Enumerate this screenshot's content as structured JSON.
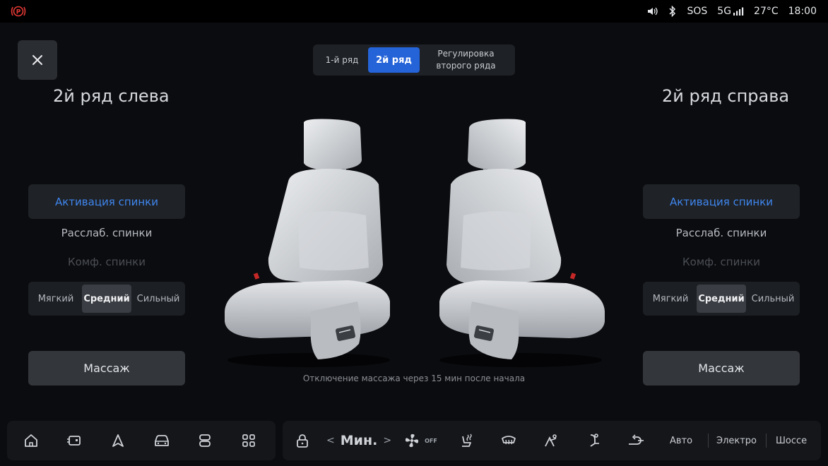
{
  "status_bar": {
    "sos": "SOS",
    "network": "5G",
    "temperature": "27°C",
    "time": "18:00",
    "icons": [
      "parking-brake-icon",
      "volume-icon",
      "bluetooth-icon",
      "signal-icon"
    ]
  },
  "tabs": [
    {
      "label": "1-й ряд",
      "active": false
    },
    {
      "label": "2й ряд",
      "active": true
    },
    {
      "label": "Регулировка второго ряда",
      "active": false
    }
  ],
  "left": {
    "title": "2й ряд слева",
    "options": [
      "Активация спинки",
      "Расслаб. спинки",
      "Комф. спинки"
    ],
    "intensity": [
      "Мягкий",
      "Средний",
      "Сильный"
    ],
    "intensity_selected": "Средний",
    "massage_label": "Массаж"
  },
  "right": {
    "title": "2й ряд справа",
    "options": [
      "Активация спинки",
      "Расслаб. спинки",
      "Комф. спинки"
    ],
    "intensity": [
      "Мягкий",
      "Средний",
      "Сильный"
    ],
    "intensity_selected": "Средний",
    "massage_label": "Массаж"
  },
  "note": "Отключение массажа через 15 мин после начала",
  "dock": {
    "left_icons": [
      "home-icon",
      "car-door-icon",
      "navigation-icon",
      "car-icon",
      "seat-control-icon",
      "apps-grid-icon"
    ],
    "lock_icon": "lock-icon",
    "temperature_label": "Мин.",
    "fan_state": "OFF",
    "climate_icons": [
      "seat-heat-icon",
      "defrost-icon",
      "airflow-face-icon",
      "airflow-feet-icon",
      "recirculation-icon"
    ],
    "modes": [
      "Авто",
      "Электро",
      "Шоссе"
    ]
  },
  "colors": {
    "accent": "#2563d9",
    "active_text": "#3f86ef",
    "background": "#0b0c0f"
  }
}
